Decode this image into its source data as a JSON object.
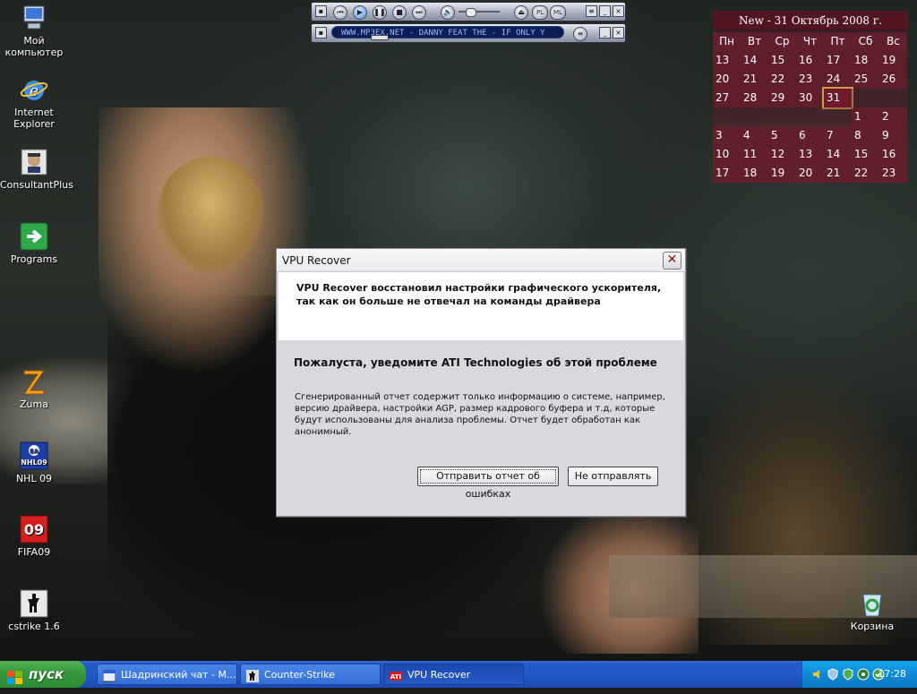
{
  "desktop": {
    "icons": [
      {
        "label": "Мой компьютер"
      },
      {
        "label": "Internet Explorer"
      },
      {
        "label": "ConsultantPlus"
      },
      {
        "label": "Programs"
      },
      {
        "label": "Zuma"
      },
      {
        "label": "NHL 09"
      },
      {
        "label": "FIFA09"
      },
      {
        "label": "cstrike 1.6"
      },
      {
        "label": "Корзина"
      }
    ]
  },
  "player": {
    "track_text": "WWW.MP3EX.NET - DANNY FEAT THE - IF ONLY Y",
    "buttons": [
      "prev-icon",
      "play-icon",
      "pause-icon",
      "stop-icon",
      "next-icon",
      "volume-icon",
      "eject-icon"
    ],
    "toggle_pl": "PL",
    "toggle_ml": "ML"
  },
  "calendar": {
    "header": "New - 31 Октябрь 2008 г.",
    "weekdays": [
      "Пн",
      "Вт",
      "Ср",
      "Чт",
      "Пт",
      "Сб",
      "Вс"
    ],
    "rows": [
      [
        "13",
        "14",
        "15",
        "16",
        "17",
        "18",
        "19"
      ],
      [
        "20",
        "21",
        "22",
        "23",
        "24",
        "25",
        "26"
      ],
      [
        "27",
        "28",
        "29",
        "30",
        "31",
        "",
        ""
      ],
      [
        "",
        "",
        "",
        "",
        "",
        "1",
        "2"
      ],
      [
        "3",
        "4",
        "5",
        "6",
        "7",
        "8",
        "9"
      ],
      [
        "10",
        "11",
        "12",
        "13",
        "14",
        "15",
        "16"
      ],
      [
        "17",
        "18",
        "19",
        "20",
        "21",
        "22",
        "23"
      ]
    ],
    "today": "31"
  },
  "dialog": {
    "title": "VPU Recover",
    "message_line1": "VPU Recover восстановил настройки графического ускорителя,",
    "message_line2": "так как он больше не отвечал на команды драйвера",
    "heading": "Пожалуста, уведомите ATI Technologies об этой проблеме",
    "body": "Сгенерированный отчет содержит только информацию о системе, например, версию драйвера, настройки AGP, размер кадрового буфера и т.д, которые будут использованы для анализа проблемы.  Отчет будет обработан как анонимный.",
    "send_button": "Отправить отчет об ошибках",
    "dont_send_button": "Не отправлять"
  },
  "taskbar": {
    "start_label": "пуск",
    "tasks": [
      {
        "label": "Шадринский чат - M..."
      },
      {
        "label": "Counter-Strike"
      },
      {
        "label": "VPU Recover"
      }
    ],
    "clock": "17:28"
  },
  "colors": {
    "taskbar_blue": "#2457c9",
    "start_green": "#3a9a3f",
    "calendar_maroon": "#781e32",
    "dialog_bg": "#d8d8de"
  }
}
